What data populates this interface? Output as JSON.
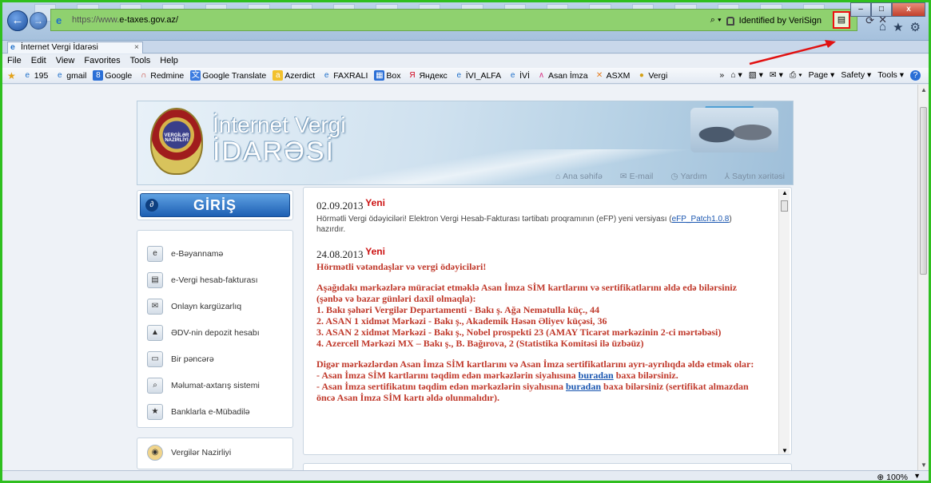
{
  "window": {
    "url_scheme": "https://www.",
    "url_domain": "e-taxes.gov.az/",
    "identified": "Identified by VeriSign",
    "min_label": "–",
    "max_label": "□",
    "close_label": "x"
  },
  "tab": {
    "title": "İnternet Vergi İdarəsi",
    "close": "×"
  },
  "menu": [
    "File",
    "Edit",
    "View",
    "Favorites",
    "Tools",
    "Help"
  ],
  "favorites": [
    {
      "label": "195",
      "icon": "e"
    },
    {
      "label": "gmail",
      "icon": "e"
    },
    {
      "label": "Google",
      "icon": "8"
    },
    {
      "label": "Redmine",
      "icon": "∩"
    },
    {
      "label": "Google Translate",
      "icon": "文"
    },
    {
      "label": "Azerdict",
      "icon": "a"
    },
    {
      "label": "FAXRALI",
      "icon": "e"
    },
    {
      "label": "Box",
      "icon": "▦"
    },
    {
      "label": "Яндекс",
      "icon": "Я"
    },
    {
      "label": "İVI_ALFA",
      "icon": "e"
    },
    {
      "label": "İVİ",
      "icon": "e"
    },
    {
      "label": "Asan İmza",
      "icon": "∧"
    },
    {
      "label": "ASXM",
      "icon": "✕"
    },
    {
      "label": "Vergi",
      "icon": "●"
    }
  ],
  "toolbar_right": {
    "more": "»",
    "page": "Page ▾",
    "safety": "Safety ▾",
    "tools": "Tools ▾",
    "help": "?"
  },
  "banner": {
    "emblem_text": "VERGİLƏR NAZİRLİYİ",
    "title_line1": "İnternet Vergi",
    "title_line2": "İDARƏSİ",
    "links": [
      {
        "icon": "⌂",
        "label": "Ana səhifə"
      },
      {
        "icon": "✉",
        "label": "E-mail"
      },
      {
        "icon": "◷",
        "label": "Yardım"
      },
      {
        "icon": "⅄",
        "label": "Saytın xəritəsi"
      }
    ]
  },
  "login": {
    "label": "GİRİŞ"
  },
  "sidebar": [
    {
      "label": "e-Bəyannamə",
      "icon": "e"
    },
    {
      "label": "e-Vergi hesab-fakturası",
      "icon": "▤"
    },
    {
      "label": "Onlayn kargüzarlıq",
      "icon": "✉"
    },
    {
      "label": "ƏDV-nin depozit hesabı",
      "icon": "▲"
    },
    {
      "label": "Bir pəncərə",
      "icon": "▭"
    },
    {
      "label": "Məlumat-axtarış sistemi",
      "icon": "⌕"
    },
    {
      "label": "Banklarla e-Mübadilə",
      "icon": "★"
    }
  ],
  "sidebar2": {
    "label": "Vergilər Nazirliyi",
    "icon": "◉"
  },
  "news": [
    {
      "date": "02.09.2013",
      "badge": "Yeni",
      "text": "Hörmətli Vergi ödəyiciləri! Elektron Vergi Hesab-Fakturası tərtibatı proqramının (eFP) yeni versiyası",
      "link": "eFP_Patch1.0.8",
      "tail": "hazırdır."
    },
    {
      "date": "24.08.2013",
      "badge": "Yeni",
      "headline": "Hörmətli vətəndaşlar və vergi ödəyiciləri!",
      "para1": "Aşağıdakı mərkəzlərə müraciət etməklə Asan İmza SİM kartlarını və sertifikatlarını əldə edə bilərsiniz (şənbə və bazar günləri daxil olmaqla):",
      "items": [
        "1. Bakı şəhəri Vergilər Departamenti - Bakı ş. Ağa Nemətulla küç., 44",
        "2. ASAN 1 xidmət Mərkəzi - Bakı ş., Akademik Həsən Əliyev küçəsi, 36",
        "3. ASAN 2 xidmət Mərkəzi - Bakı ş., Nobel prospekti 23 (AMAY Ticarət mərkəzinin 2-ci mərtəbəsi)",
        "4. Azercell Mərkəzi MX – Bakı ş., B. Bağırova, 2 (Statistika Komitəsi ilə üzbəüz)"
      ],
      "para2": "Digər mərkəzlərdən Asan İmza SİM kartlarını və Asan İmza sertifikatlarını ayrı-ayrılıqda əldə etmək olar:",
      "line_a_pre": "- Asan İmza SİM kartlarını təqdim edən mərkəzlərin siyahısına",
      "line_a_link": "buradan",
      "line_a_post": "baxa bilərsiniz.",
      "line_b_pre": "- Asan İmza sertifikatını təqdim edən mərkəzlərin siyahısına",
      "line_b_link": "buradan",
      "line_b_post": "baxa bilərsiniz (sertifikat almazdan öncə Asan İmza SİM kartı əldə olunmalıdır)."
    }
  ],
  "status": {
    "zoom": "100%"
  },
  "colors": {
    "highlight_border": "#2fbf1f",
    "annotation": "#e11111"
  }
}
